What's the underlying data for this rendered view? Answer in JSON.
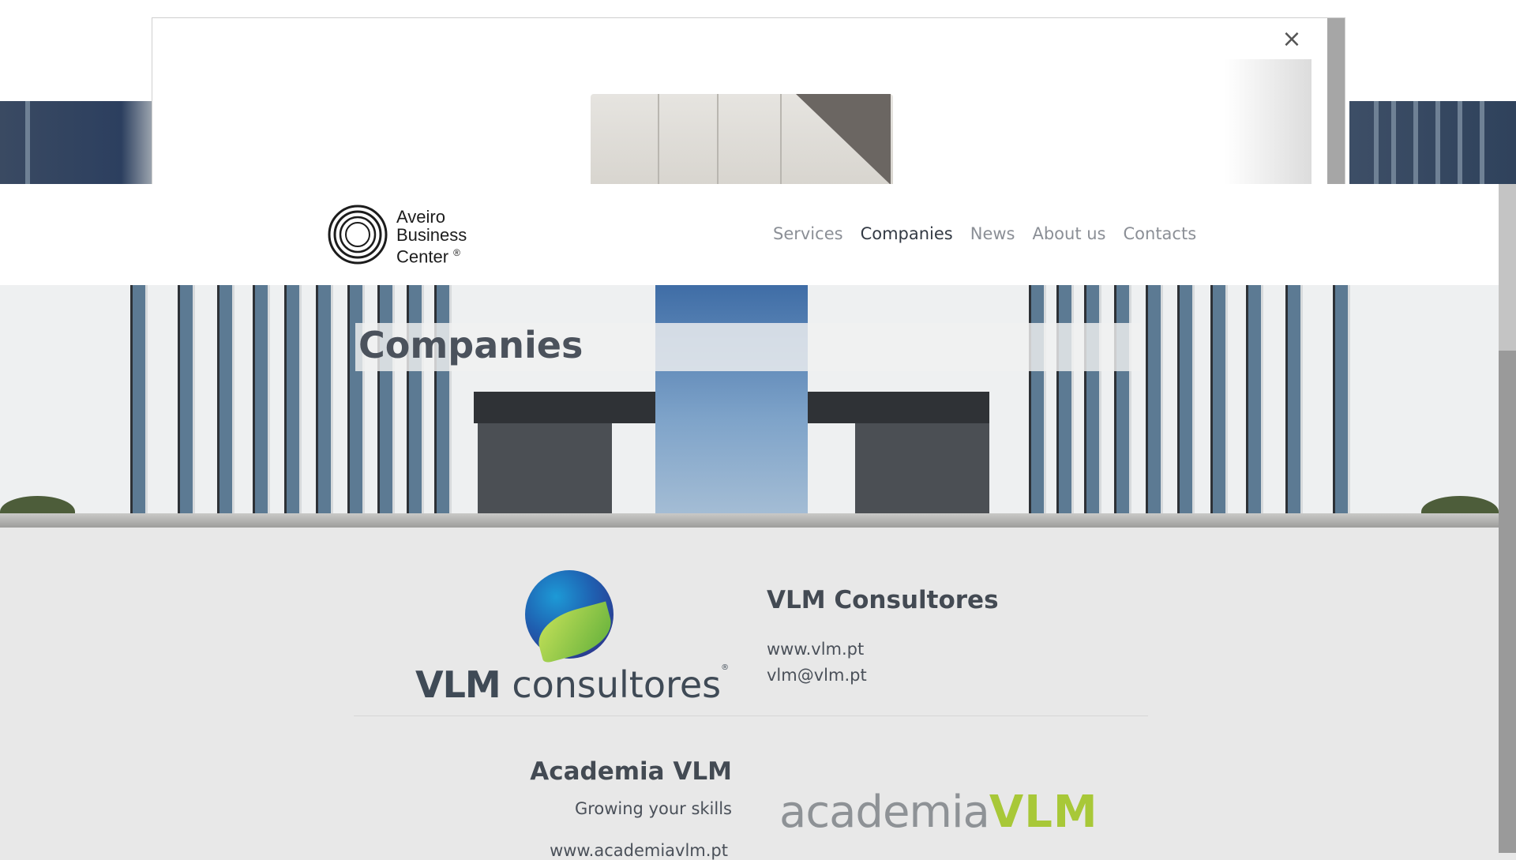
{
  "modal": {
    "close_label": "×"
  },
  "brand": {
    "line1": "Aveiro",
    "line2": "Business",
    "line3": "Center",
    "mark": "®"
  },
  "nav": {
    "items": [
      {
        "label": "Services",
        "active": false
      },
      {
        "label": "Companies",
        "active": true
      },
      {
        "label": "News",
        "active": false
      },
      {
        "label": "About us",
        "active": false
      },
      {
        "label": "Contacts",
        "active": false
      }
    ]
  },
  "hero": {
    "title": "Companies"
  },
  "companies": [
    {
      "name": "VLM Consultores",
      "logo_text_bold": "VLM",
      "logo_text_rest": "consultores",
      "logo_mark": "®",
      "website": "www.vlm.pt",
      "email": "vlm@vlm.pt"
    },
    {
      "name": "Academia VLM",
      "tagline": "Growing your skills",
      "website": "www.academiavlm.pt",
      "logo_text_light": "academia",
      "logo_text_bold": "VLM"
    }
  ],
  "colors": {
    "accent_green": "#a8c838",
    "text_dark": "#434a53",
    "nav_muted": "#8b8f96"
  }
}
